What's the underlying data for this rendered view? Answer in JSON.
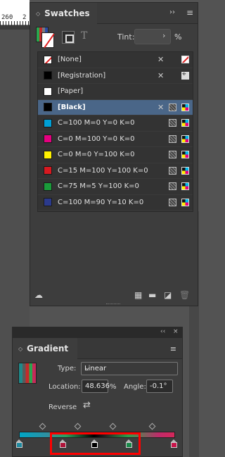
{
  "ruler": {
    "tick_left": "260",
    "tick_right": "2"
  },
  "swatches": {
    "tab_title": "Swatches",
    "collapse_glyph": "››",
    "menu_glyph": "≡",
    "tint_label": "Tint:",
    "tint_value": "",
    "tint_unit": "%",
    "text_btn": "T",
    "items": [
      {
        "name": "[None]",
        "color": "none",
        "locked": true,
        "mode": "none"
      },
      {
        "name": "[Registration]",
        "color": "#000000",
        "locked": true,
        "mode": "registration"
      },
      {
        "name": "[Paper]",
        "color": "#ffffff",
        "locked": false,
        "mode": ""
      },
      {
        "name": "[Black]",
        "color": "#000000",
        "locked": true,
        "mode": "cmyk",
        "selected": true
      },
      {
        "name": "C=100 M=0 Y=0 K=0",
        "color": "#00a0d6",
        "mode": "cmyk"
      },
      {
        "name": "C=0 M=100 Y=0 K=0",
        "color": "#e4007f",
        "mode": "cmyk"
      },
      {
        "name": "C=0 M=0 Y=100 K=0",
        "color": "#fff100",
        "mode": "cmyk"
      },
      {
        "name": "C=15 M=100 Y=100 K=0",
        "color": "#d71920",
        "mode": "cmyk"
      },
      {
        "name": "C=75 M=5 Y=100 K=0",
        "color": "#1a9b3a",
        "mode": "cmyk"
      },
      {
        "name": "C=100 M=90 Y=10 K=0",
        "color": "#2b3a8c",
        "mode": "cmyk"
      }
    ],
    "bottom_icons": [
      "cc-libraries-icon",
      "swatch-views-icon",
      "new-color-group-icon",
      "new-swatch-icon",
      "delete-swatch-icon"
    ]
  },
  "gradient": {
    "collapse_glyph": "‹‹",
    "close_glyph": "×",
    "tab_title": "Gradient",
    "menu_glyph": "≡",
    "type_label": "Type:",
    "type_value": "Linear",
    "location_label": "Location:",
    "location_value": "48.636",
    "location_unit": "%",
    "angle_label": "Angle:",
    "angle_value": "-0.1°",
    "reverse_label": "Reverse",
    "stops": [
      {
        "color": "#1f8aa0",
        "selected": false
      },
      {
        "color": "#b0143a",
        "selected": false
      },
      {
        "color": "#000000",
        "selected": true
      },
      {
        "color": "#1a8a4a",
        "selected": false
      },
      {
        "color": "#c8144a",
        "selected": false
      }
    ]
  }
}
